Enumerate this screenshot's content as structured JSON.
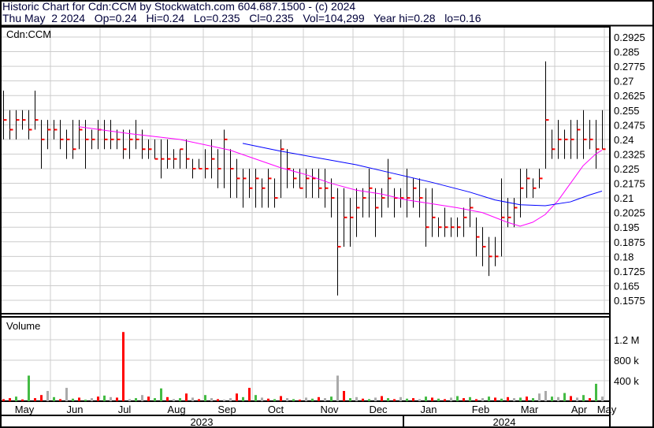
{
  "header": {
    "title": "Historic Chart for Cdn:CCM by Stockwatch.com 604.687.1500 - (c) 2024",
    "quote": "Thu May  2 2024   Op=0.24   Hi=0.24   Lo=0.235   Cl=0.235   Vol=104,299   Year hi=0.28   lo=0.16"
  },
  "chart_data": {
    "type": "line",
    "symbol": "Cdn:CCM",
    "volume_label": "Volume",
    "price_ticks": [
      "0.2925",
      "0.285",
      "0.2775",
      "0.27",
      "0.2625",
      "0.255",
      "0.2475",
      "0.24",
      "0.2325",
      "0.225",
      "0.2175",
      "0.21",
      "0.2025",
      "0.195",
      "0.1875",
      "0.18",
      "0.1725",
      "0.165",
      "0.1575"
    ],
    "ylim": [
      0.1575,
      0.2925
    ],
    "volume_ticks": [
      {
        "label": "1.2 M",
        "v": 1200
      },
      {
        "label": "800 k",
        "v": 800
      },
      {
        "label": "400 k",
        "v": 400
      }
    ],
    "months": [
      "May",
      "Jun",
      "Jul",
      "Aug",
      "Sep",
      "Oct",
      "Nov",
      "Dec",
      "Jan",
      "Feb",
      "Mar",
      "Apr",
      "May"
    ],
    "years": [
      "2023",
      "2024"
    ],
    "colors": {
      "bar": "#000000",
      "close": "#ff0000",
      "ma_short": "#ff00ff",
      "ma_long": "#0000ff",
      "vol_up": "#44bb44",
      "vol_down": "#ff0000",
      "vol_flat": "#aaaaaa"
    },
    "ohlc_hlc": [
      [
        0.265,
        0.24,
        0.25
      ],
      [
        0.255,
        0.24,
        0.245
      ],
      [
        0.255,
        0.24,
        0.25
      ],
      [
        0.255,
        0.245,
        0.25
      ],
      [
        0.255,
        0.24,
        0.245
      ],
      [
        0.265,
        0.245,
        0.25
      ],
      [
        0.25,
        0.225,
        0.24
      ],
      [
        0.25,
        0.235,
        0.245
      ],
      [
        0.25,
        0.24,
        0.245
      ],
      [
        0.25,
        0.235,
        0.24
      ],
      [
        0.245,
        0.23,
        0.24
      ],
      [
        0.25,
        0.23,
        0.235
      ],
      [
        0.25,
        0.235,
        0.245
      ],
      [
        0.25,
        0.225,
        0.24
      ],
      [
        0.245,
        0.235,
        0.24
      ],
      [
        0.25,
        0.235,
        0.245
      ],
      [
        0.25,
        0.235,
        0.24
      ],
      [
        0.25,
        0.235,
        0.24
      ],
      [
        0.245,
        0.235,
        0.24
      ],
      [
        0.245,
        0.23,
        0.235
      ],
      [
        0.245,
        0.23,
        0.24
      ],
      [
        0.25,
        0.235,
        0.24
      ],
      [
        0.245,
        0.23,
        0.235
      ],
      [
        0.24,
        0.23,
        0.235
      ],
      [
        0.24,
        0.23,
        0.23
      ],
      [
        0.24,
        0.22,
        0.23
      ],
      [
        0.24,
        0.225,
        0.23
      ],
      [
        0.235,
        0.225,
        0.23
      ],
      [
        0.235,
        0.225,
        0.235
      ],
      [
        0.24,
        0.225,
        0.23
      ],
      [
        0.23,
        0.22,
        0.225
      ],
      [
        0.23,
        0.225,
        0.225
      ],
      [
        0.235,
        0.22,
        0.225
      ],
      [
        0.24,
        0.22,
        0.23
      ],
      [
        0.235,
        0.215,
        0.225
      ],
      [
        0.245,
        0.215,
        0.24
      ],
      [
        0.235,
        0.21,
        0.225
      ],
      [
        0.23,
        0.21,
        0.22
      ],
      [
        0.225,
        0.205,
        0.22
      ],
      [
        0.225,
        0.21,
        0.215
      ],
      [
        0.225,
        0.205,
        0.22
      ],
      [
        0.22,
        0.205,
        0.215
      ],
      [
        0.225,
        0.205,
        0.22
      ],
      [
        0.22,
        0.205,
        0.21
      ],
      [
        0.24,
        0.21,
        0.235
      ],
      [
        0.235,
        0.215,
        0.225
      ],
      [
        0.225,
        0.215,
        0.22
      ],
      [
        0.225,
        0.215,
        0.215
      ],
      [
        0.225,
        0.21,
        0.22
      ],
      [
        0.225,
        0.21,
        0.22
      ],
      [
        0.225,
        0.21,
        0.215
      ],
      [
        0.225,
        0.205,
        0.215
      ],
      [
        0.22,
        0.2,
        0.21
      ],
      [
        0.215,
        0.16,
        0.185
      ],
      [
        0.215,
        0.185,
        0.2
      ],
      [
        0.21,
        0.185,
        0.2
      ],
      [
        0.215,
        0.19,
        0.205
      ],
      [
        0.215,
        0.2,
        0.21
      ],
      [
        0.225,
        0.2,
        0.215
      ],
      [
        0.215,
        0.19,
        0.205
      ],
      [
        0.215,
        0.2,
        0.21
      ],
      [
        0.23,
        0.205,
        0.22
      ],
      [
        0.215,
        0.2,
        0.21
      ],
      [
        0.215,
        0.205,
        0.21
      ],
      [
        0.225,
        0.2,
        0.21
      ],
      [
        0.22,
        0.205,
        0.215
      ],
      [
        0.22,
        0.2,
        0.21
      ],
      [
        0.215,
        0.185,
        0.195
      ],
      [
        0.215,
        0.19,
        0.2
      ],
      [
        0.2,
        0.19,
        0.195
      ],
      [
        0.205,
        0.19,
        0.195
      ],
      [
        0.2,
        0.19,
        0.195
      ],
      [
        0.2,
        0.19,
        0.195
      ],
      [
        0.205,
        0.19,
        0.2
      ],
      [
        0.21,
        0.195,
        0.205
      ],
      [
        0.2,
        0.18,
        0.19
      ],
      [
        0.195,
        0.175,
        0.185
      ],
      [
        0.19,
        0.17,
        0.18
      ],
      [
        0.19,
        0.175,
        0.18
      ],
      [
        0.22,
        0.18,
        0.2
      ],
      [
        0.21,
        0.195,
        0.2
      ],
      [
        0.21,
        0.195,
        0.205
      ],
      [
        0.225,
        0.2,
        0.215
      ],
      [
        0.225,
        0.21,
        0.22
      ],
      [
        0.22,
        0.21,
        0.215
      ],
      [
        0.225,
        0.215,
        0.22
      ],
      [
        0.28,
        0.225,
        0.25
      ],
      [
        0.245,
        0.23,
        0.235
      ],
      [
        0.25,
        0.23,
        0.24
      ],
      [
        0.245,
        0.23,
        0.24
      ],
      [
        0.25,
        0.23,
        0.24
      ],
      [
        0.25,
        0.23,
        0.245
      ],
      [
        0.255,
        0.23,
        0.24
      ],
      [
        0.25,
        0.235,
        0.24
      ],
      [
        0.25,
        0.225,
        0.235
      ],
      [
        0.255,
        0.235,
        0.235
      ]
    ],
    "volume_k": [
      40,
      60,
      90,
      35,
      500,
      60,
      120,
      200,
      80,
      40,
      260,
      50,
      70,
      30,
      60,
      90,
      110,
      80,
      70,
      1350,
      40,
      60,
      120,
      90,
      60,
      250,
      80,
      40,
      60,
      150,
      70,
      40,
      120,
      60,
      40,
      30,
      60,
      150,
      80,
      260,
      120,
      70,
      50,
      40,
      100,
      60,
      40,
      30,
      70,
      50,
      80,
      60,
      90,
      500,
      200,
      60,
      80,
      50,
      40,
      70,
      100,
      60,
      40,
      80,
      50,
      60,
      40,
      90,
      70,
      50,
      40,
      70,
      100,
      60,
      80,
      40,
      60,
      90,
      70,
      50,
      80,
      60,
      70,
      90,
      60,
      150,
      200,
      90,
      80,
      160,
      100,
      70,
      120,
      60,
      340,
      90
    ],
    "volume_dir": [
      "d",
      "d",
      "u",
      "d",
      "u",
      "d",
      "d",
      "f",
      "u",
      "d",
      "f",
      "u",
      "d",
      "u",
      "f",
      "d",
      "u",
      "f",
      "d",
      "d",
      "f",
      "u",
      "f",
      "d",
      "u",
      "u",
      "d",
      "f",
      "u",
      "d",
      "f",
      "d",
      "u",
      "f",
      "d",
      "f",
      "f",
      "d",
      "u",
      "d",
      "u",
      "f",
      "d",
      "u",
      "d",
      "f",
      "u",
      "d",
      "f",
      "u",
      "d",
      "f",
      "u",
      "f",
      "d",
      "u",
      "f",
      "d",
      "u",
      "f",
      "d",
      "u",
      "d",
      "f",
      "u",
      "d",
      "f",
      "u",
      "d",
      "u",
      "d",
      "f",
      "u",
      "d",
      "u",
      "d",
      "f",
      "u",
      "d",
      "u",
      "d",
      "f",
      "u",
      "d",
      "u",
      "f",
      "f",
      "u",
      "f",
      "u",
      "d",
      "f",
      "u",
      "d",
      "u",
      "f"
    ],
    "ma_short": [
      [
        12,
        0.2465
      ],
      [
        20,
        0.243
      ],
      [
        28,
        0.24
      ],
      [
        36,
        0.2345
      ],
      [
        40,
        0.23
      ],
      [
        44,
        0.2255
      ],
      [
        48,
        0.222
      ],
      [
        52,
        0.2175
      ],
      [
        56,
        0.214
      ],
      [
        60,
        0.212
      ],
      [
        64,
        0.209
      ],
      [
        68,
        0.207
      ],
      [
        72,
        0.205
      ],
      [
        76,
        0.2025
      ],
      [
        80,
        0.1975
      ],
      [
        82,
        0.1955
      ],
      [
        84,
        0.1975
      ],
      [
        86,
        0.2015
      ],
      [
        88,
        0.2085
      ],
      [
        90,
        0.2175
      ],
      [
        92,
        0.2265
      ],
      [
        94,
        0.2325
      ],
      [
        95,
        0.2345
      ]
    ],
    "ma_long": [
      [
        38,
        0.238
      ],
      [
        44,
        0.234
      ],
      [
        50,
        0.2305
      ],
      [
        56,
        0.227
      ],
      [
        62,
        0.2225
      ],
      [
        68,
        0.218
      ],
      [
        74,
        0.213
      ],
      [
        78,
        0.209
      ],
      [
        82,
        0.2065
      ],
      [
        86,
        0.206
      ],
      [
        90,
        0.208
      ],
      [
        93,
        0.2115
      ],
      [
        95,
        0.2135
      ]
    ]
  }
}
